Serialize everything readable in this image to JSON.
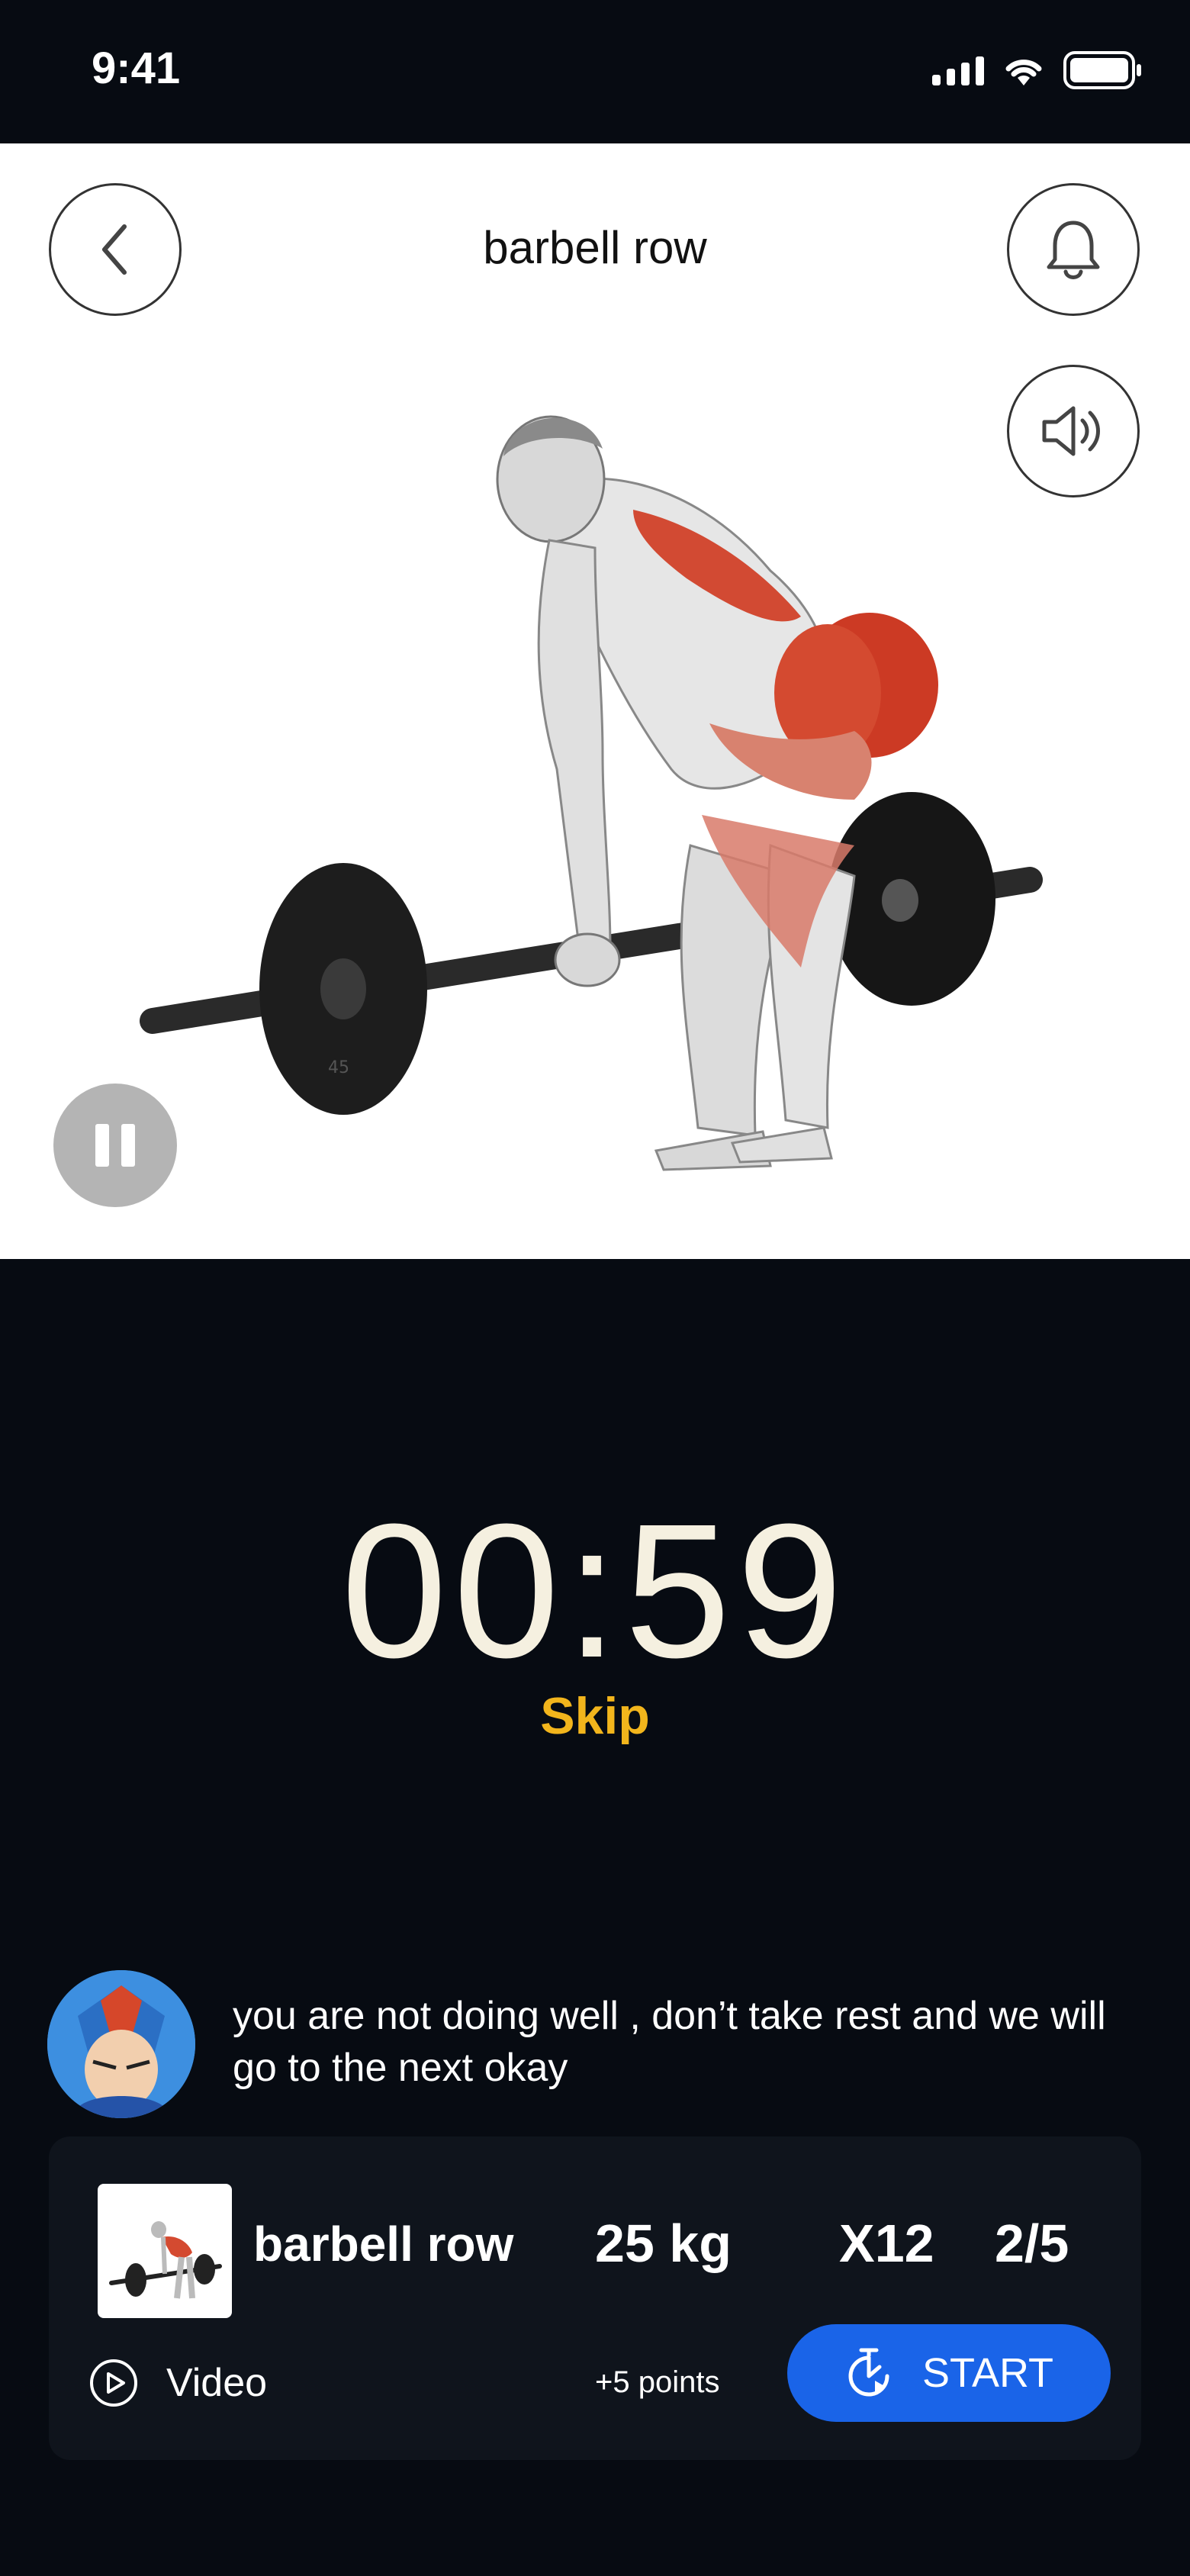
{
  "status_bar": {
    "time": "9:41"
  },
  "hero": {
    "title": "barbell row",
    "plate_label": "45"
  },
  "timer": {
    "value": "00:59",
    "skip_label": "Skip"
  },
  "coach": {
    "message": "you are not doing well , don’t take rest and we will\ngo to the next okay"
  },
  "exercise_card": {
    "name": "barbell row",
    "weight": "25 kg",
    "reps": "X12",
    "sets": "2/5",
    "video_label": "Video",
    "points": "+5 points",
    "start_label": "START"
  },
  "colors": {
    "background": "#070b12",
    "card": "#0f141c",
    "accent": "#f2b51c",
    "primary": "#1a64e8",
    "timer": "#f5f0e0"
  }
}
